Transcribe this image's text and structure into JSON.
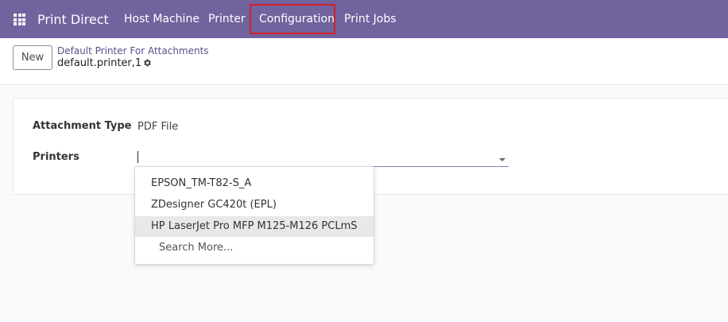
{
  "navbar": {
    "brand": "Print Direct",
    "items": [
      "Host Machine",
      "Printer",
      "Configuration",
      "Print Jobs"
    ]
  },
  "control": {
    "new_label": "New",
    "breadcrumb": "Default Printer For Attachments",
    "record_name": "default.printer,1"
  },
  "form": {
    "attachment_type_label": "Attachment Type",
    "attachment_type_value": "PDF File",
    "printers_label": "Printers",
    "printers_value": ""
  },
  "dropdown": {
    "options": [
      "EPSON_TM-T82-S_A",
      "ZDesigner GC420t (EPL)",
      "HP LaserJet Pro MFP M125-M126 PCLmS"
    ],
    "search_more": "Search More..."
  },
  "colors": {
    "navbar": "#71639e",
    "highlight": "#d0202a",
    "breadcrumb": "#5b4f8c"
  }
}
